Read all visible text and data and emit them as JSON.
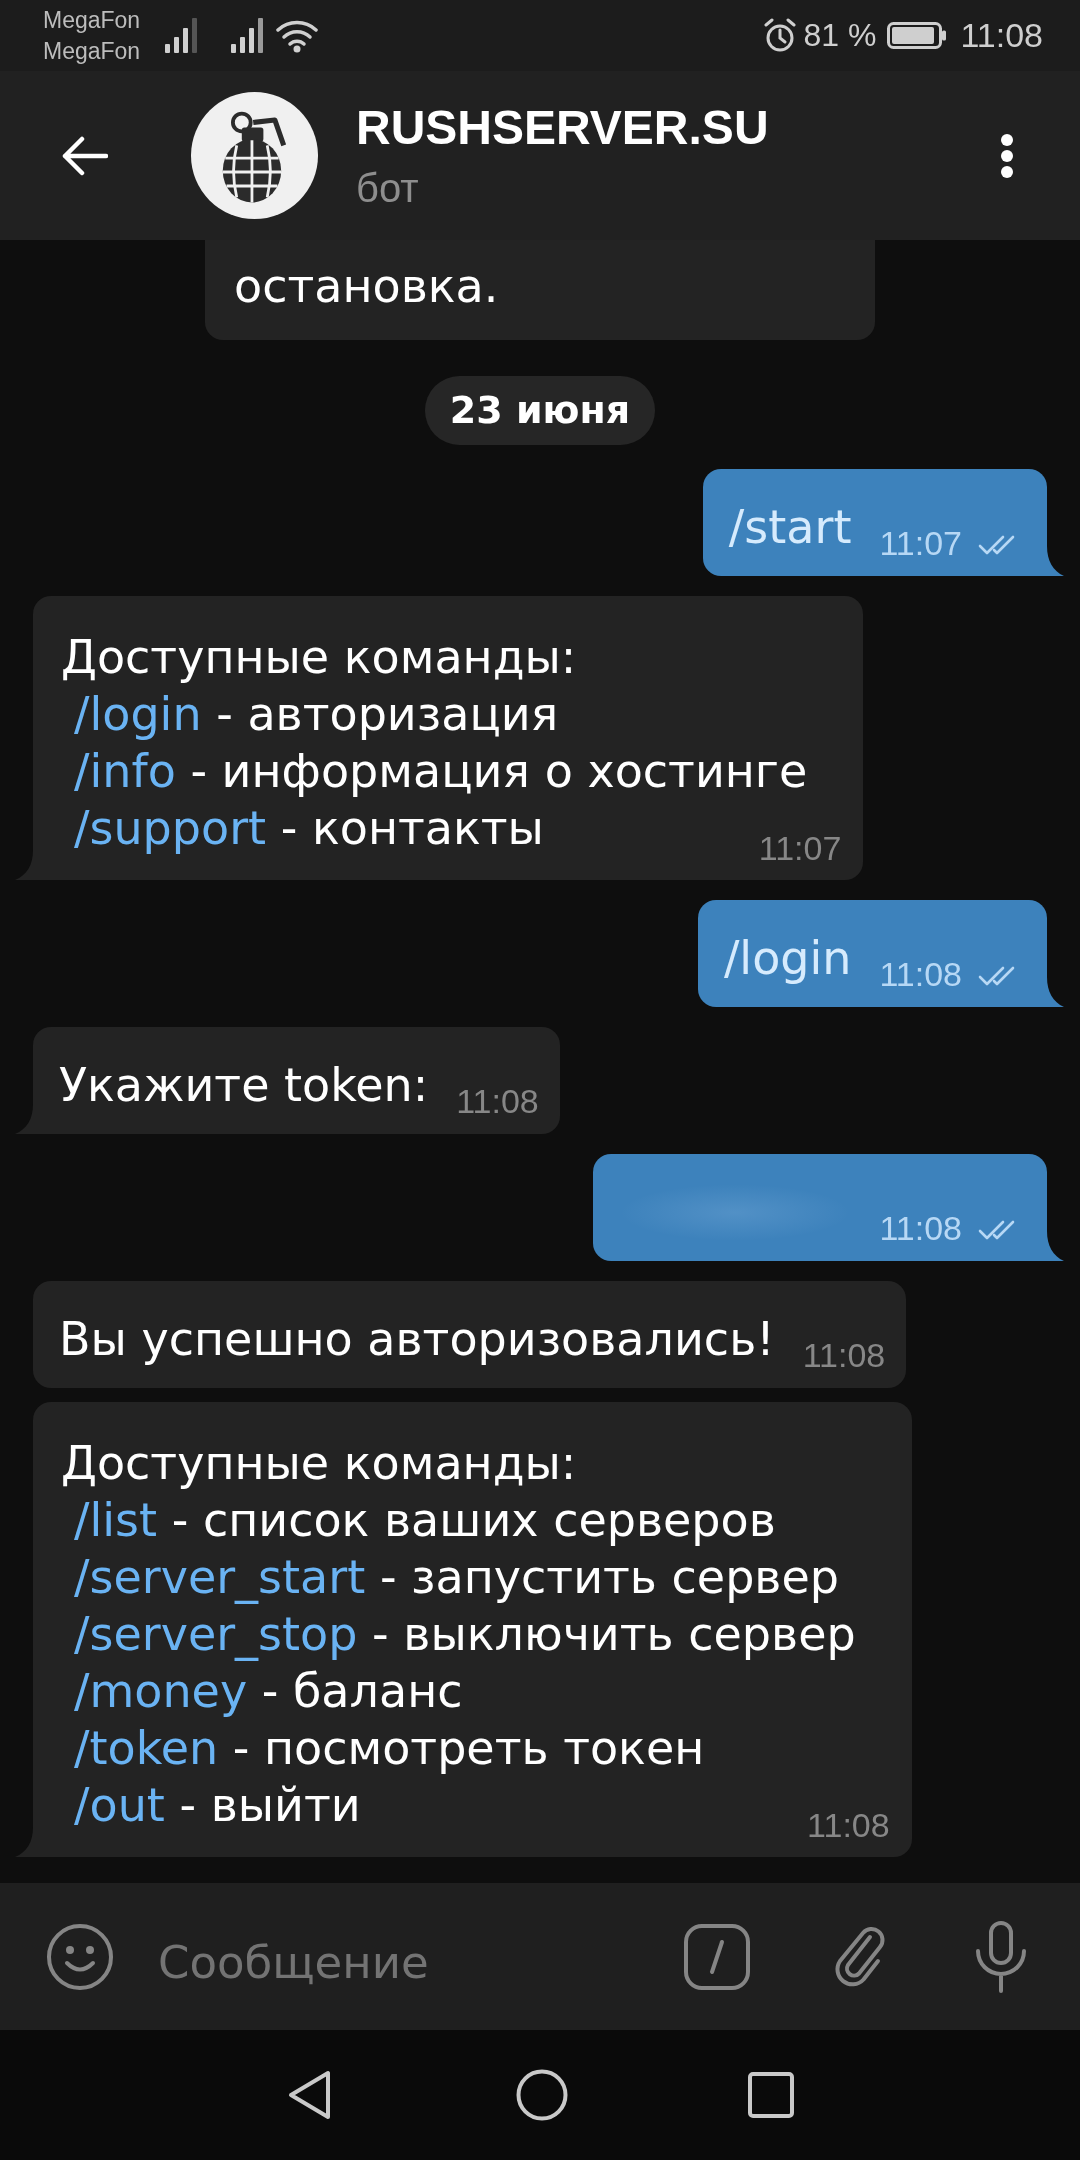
{
  "status_bar": {
    "carriers": [
      "MegaFon",
      "MegaFon"
    ],
    "battery": "81 %",
    "time": "11:08"
  },
  "header": {
    "title": "RUSHSERVER.SU",
    "subtitle": "бот"
  },
  "messages": [
    {
      "kind": "bot_info",
      "text": "остановка."
    },
    {
      "kind": "date",
      "text": "23 июня"
    },
    {
      "kind": "outgoing",
      "text": "/start",
      "time": "11:07",
      "read": true,
      "tail": true
    },
    {
      "kind": "incoming",
      "heading": "Доступные команды:",
      "commands": [
        {
          "command": "/login",
          "description": "- авторизация"
        },
        {
          "command": "/info",
          "description": "- информация о хостинге"
        },
        {
          "command": "/support",
          "description": "- контакты"
        }
      ],
      "time": "11:07",
      "tail": true
    },
    {
      "kind": "outgoing",
      "text": "/login",
      "time": "11:08",
      "read": true,
      "tail": true
    },
    {
      "kind": "incoming",
      "text": "Укажите token:",
      "time": "11:08",
      "tail": true
    },
    {
      "kind": "outgoing",
      "redacted": true,
      "time": "11:08",
      "read": true,
      "tail": true
    },
    {
      "kind": "incoming",
      "text": "Вы успешно авторизовались!",
      "time": "11:08",
      "tail": false
    },
    {
      "kind": "incoming",
      "heading": "Доступные команды:",
      "commands": [
        {
          "command": "/list",
          "description": "- список ваших серверов"
        },
        {
          "command": "/server_start",
          "description": "- запустить сервер"
        },
        {
          "command": "/server_stop",
          "description": "- выключить сервер"
        },
        {
          "command": "/money",
          "description": "- баланс"
        },
        {
          "command": "/token",
          "description": "- посмотреть токен"
        },
        {
          "command": "/out",
          "description": "- выйти"
        }
      ],
      "time": "11:08",
      "tail": true
    }
  ],
  "composer": {
    "placeholder": "Сообщение"
  }
}
